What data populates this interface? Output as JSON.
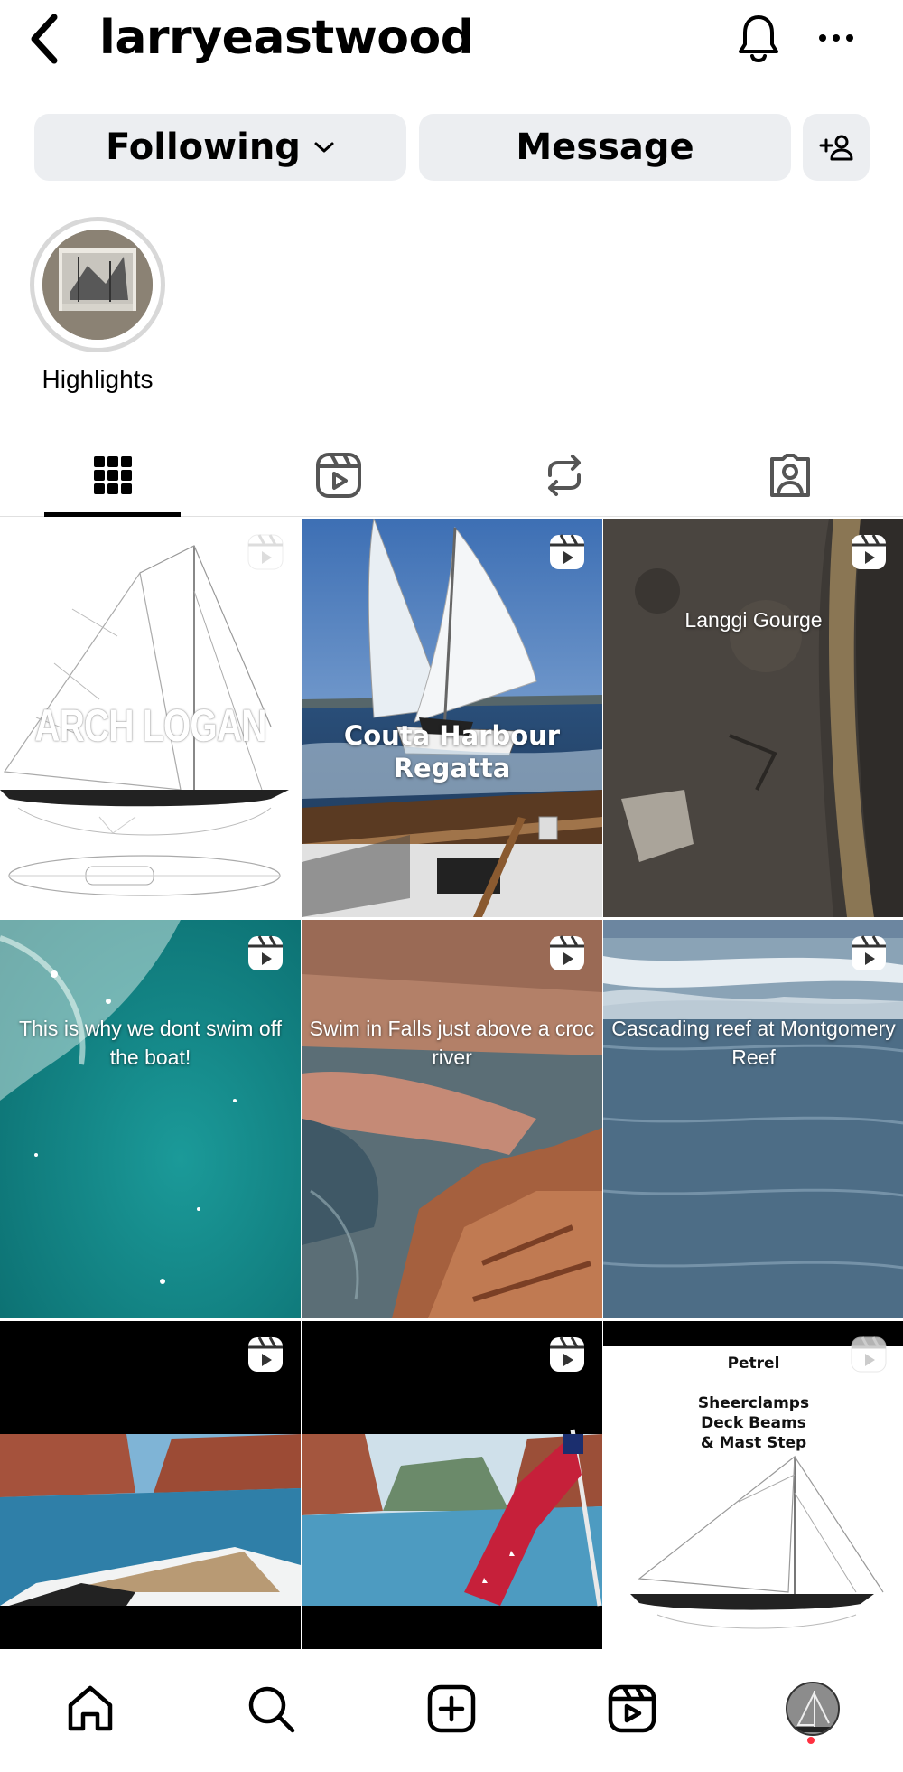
{
  "header": {
    "username": "larryeastwood"
  },
  "actions": {
    "following_label": "Following",
    "message_label": "Message"
  },
  "highlights": [
    {
      "label": "Highlights"
    }
  ],
  "tabs": [
    {
      "icon": "grid-icon",
      "active": true
    },
    {
      "icon": "reels-icon",
      "active": false
    },
    {
      "icon": "reposts-icon",
      "active": false
    },
    {
      "icon": "tagged-icon",
      "active": false
    }
  ],
  "posts": [
    {
      "type": "reel",
      "overlay_text": "ARCH LOGAN"
    },
    {
      "type": "reel",
      "caption": "Couta Harbour Regatta"
    },
    {
      "type": "reel",
      "caption": "Langgi Gourge"
    },
    {
      "type": "reel",
      "caption": "This is why we dont swim off the boat!"
    },
    {
      "type": "reel",
      "caption": "Swim in Falls just above a croc river"
    },
    {
      "type": "reel",
      "caption": "Cascading reef at Montgomery Reef"
    },
    {
      "type": "reel",
      "caption": ""
    },
    {
      "type": "reel",
      "caption": ""
    },
    {
      "type": "reel",
      "title": "Petrel",
      "subtitle_lines": [
        "Sheerclamps",
        "Deck Beams",
        "& Mast Step"
      ]
    }
  ],
  "bottom_nav": [
    {
      "icon": "home-icon"
    },
    {
      "icon": "search-icon"
    },
    {
      "icon": "create-icon"
    },
    {
      "icon": "reels-icon"
    },
    {
      "icon": "profile-avatar"
    }
  ],
  "colors": {
    "button_bg": "#eceef1",
    "notification_dot": "#ff3040"
  }
}
